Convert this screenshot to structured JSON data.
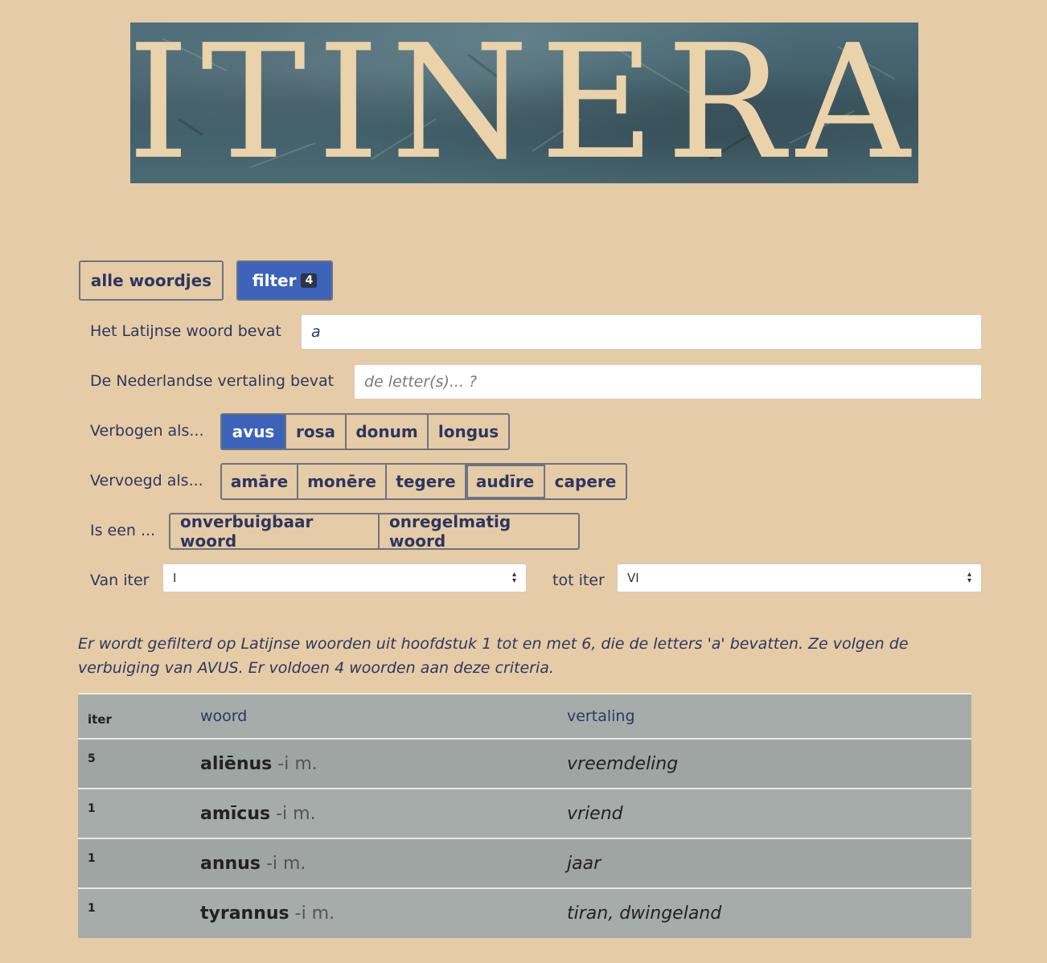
{
  "banner": {
    "title": "ITINERA"
  },
  "tabs": {
    "all_label": "alle woordjes",
    "filter_label": "filter",
    "filter_count": "4"
  },
  "filters": {
    "latin_label": "Het Latijnse woord bevat",
    "latin_value": "a",
    "dutch_label": "De Nederlandse vertaling bevat",
    "dutch_placeholder": "de letter(s)... ?",
    "declension_label": "Verbogen als...",
    "declension_options": [
      "avus",
      "rosa",
      "donum",
      "longus"
    ],
    "declension_selected": "avus",
    "conjugation_label": "Vervoegd als...",
    "conjugation_options": [
      "amāre",
      "monēre",
      "tegere",
      "audīre",
      "capere"
    ],
    "type_label": "Is een ...",
    "type_options": [
      "onverbuigbaar woord",
      "onregelmatig woord"
    ],
    "from_label": "Van iter",
    "from_value": "I",
    "to_label": "tot iter",
    "to_value": "VI"
  },
  "summary": "Er wordt gefilterd op Latijnse woorden uit hoofdstuk 1 tot en met 6, die de letters 'a' bevatten. Ze volgen de verbuiging van AVUS. Er voldoen 4 woorden aan deze criteria.",
  "table": {
    "headers": {
      "iter": "iter",
      "woord": "woord",
      "vertaling": "vertaling"
    },
    "rows": [
      {
        "iter": "5",
        "word": "aliēnus",
        "suffix": "-i m.",
        "translation": "vreemdeling"
      },
      {
        "iter": "1",
        "word": "amīcus",
        "suffix": "-i m.",
        "translation": "vriend"
      },
      {
        "iter": "1",
        "word": "annus",
        "suffix": "-i m.",
        "translation": "jaar"
      },
      {
        "iter": "1",
        "word": "tyrannus",
        "suffix": "-i m.",
        "translation": "tiran, dwingeland"
      }
    ]
  },
  "colors": {
    "background": "#e6cba7",
    "primary": "#3d62b9",
    "text": "#2b3760",
    "table_row": "#a6aca9"
  }
}
